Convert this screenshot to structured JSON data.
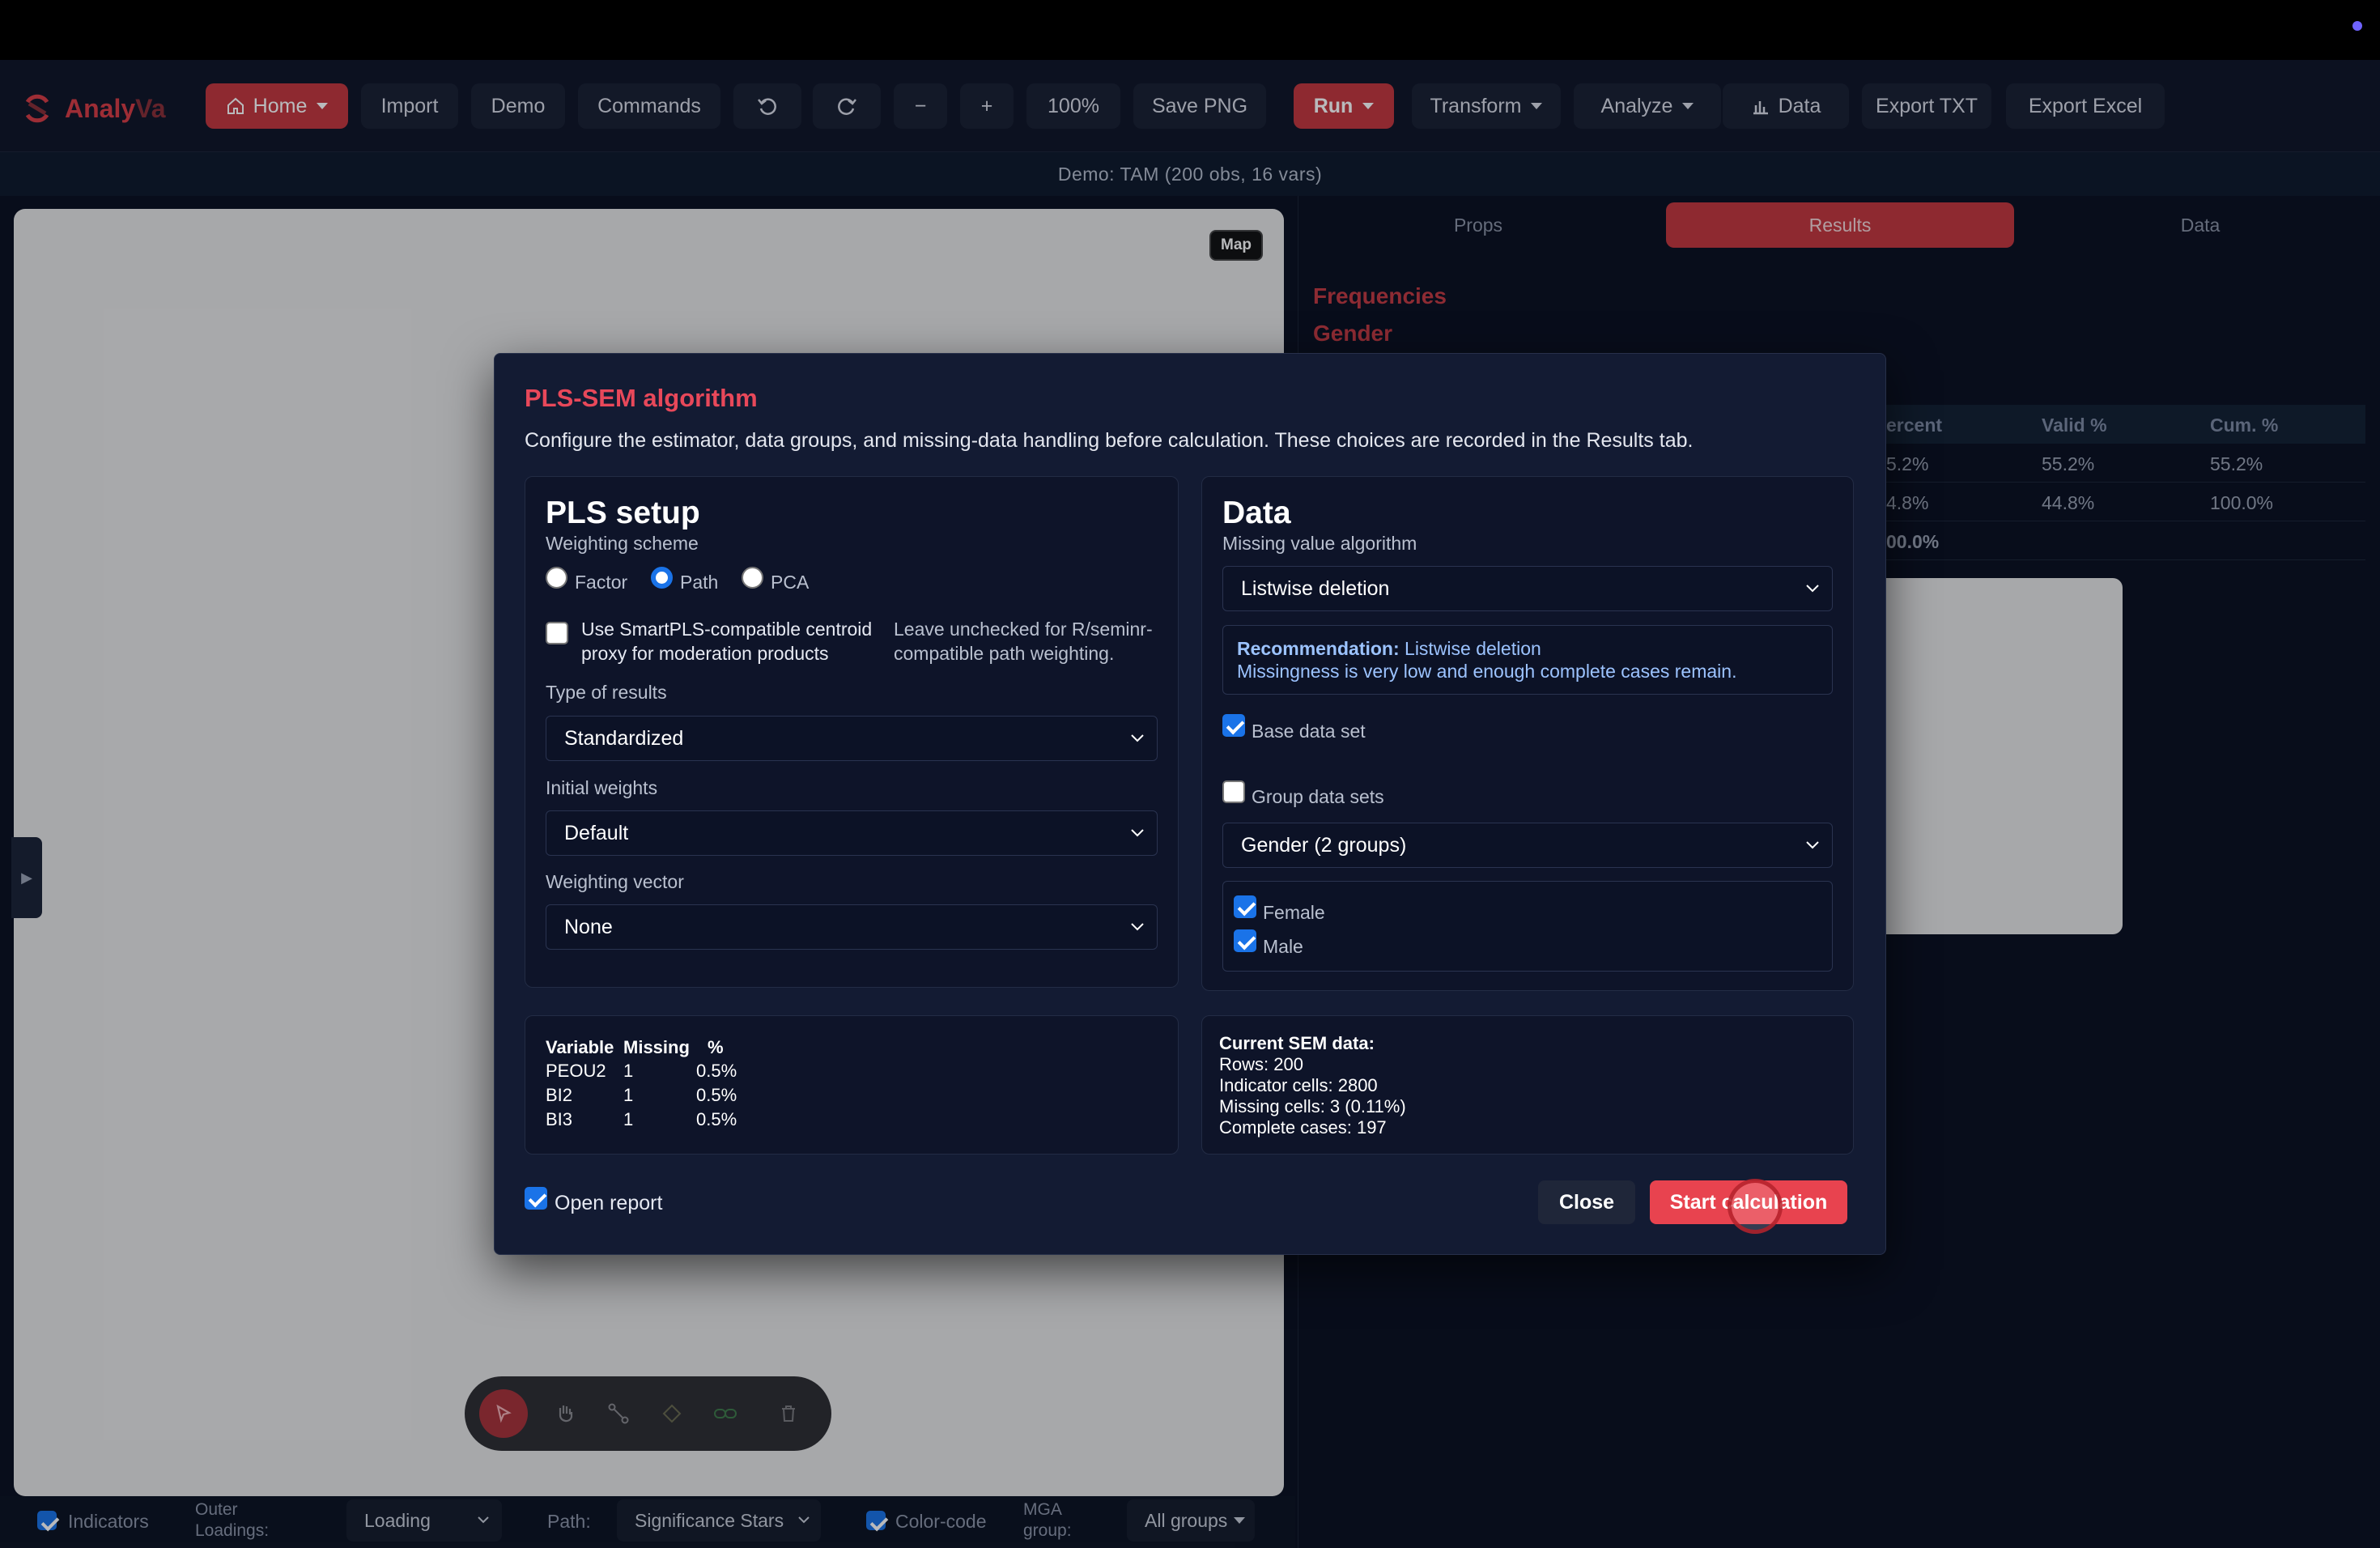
{
  "app": {
    "name_part1": "Analy",
    "name_part2": "Va"
  },
  "toolbar": {
    "home": "Home",
    "import": "Import",
    "demo": "Demo",
    "commands": "Commands",
    "minus": "−",
    "plus": "+",
    "zoom": "100%",
    "save_png": "Save PNG",
    "run": "Run",
    "transform": "Transform",
    "analyze": "Analyze",
    "data": "Data",
    "export_txt": "Export TXT",
    "export_excel": "Export Excel"
  },
  "demo_bar": "Demo: TAM (200 obs, 16 vars)",
  "canvas": {
    "map_label": "Map",
    "side_toggle": "▶"
  },
  "bottom_bar": {
    "indicators": "Indicators",
    "outer_loadings_1": "Outer",
    "outer_loadings_2": "Loadings:",
    "loading_value": "Loading",
    "path_label": "Path:",
    "path_value": "Significance Stars",
    "color_code": "Color-code",
    "mga_1": "MGA",
    "mga_2": "group:",
    "mga_value": "All groups"
  },
  "right_panel": {
    "tabs": [
      "Props",
      "Results",
      "Data"
    ],
    "active_tab": "Results",
    "section_title": "Frequencies",
    "variable": "Gender",
    "table": {
      "headers": [
        "ercent",
        "Valid %",
        "Cum. %"
      ],
      "rows": [
        [
          "5.2%",
          "55.2%",
          "55.2%"
        ],
        [
          "4.8%",
          "44.8%",
          "100.0%"
        ],
        [
          "00.0%",
          "",
          ""
        ]
      ]
    }
  },
  "modal": {
    "title": "PLS-SEM algorithm",
    "description": "Configure the estimator, data groups, and missing-data handling before calculation. These choices are recorded in the Results tab.",
    "pls_setup": {
      "heading": "PLS setup",
      "weighting_scheme_label": "Weighting scheme",
      "schemes": [
        "Factor",
        "Path",
        "PCA"
      ],
      "selected_scheme": "Path",
      "centroid_line1": "Use SmartPLS-compatible centroid",
      "centroid_line2": "proxy for moderation products",
      "centroid_hint1": "Leave unchecked for R/seminr-",
      "centroid_hint2": "compatible path weighting.",
      "type_of_results_label": "Type of results",
      "type_of_results": "Standardized",
      "initial_weights_label": "Initial weights",
      "initial_weights": "Default",
      "weighting_vector_label": "Weighting vector",
      "weighting_vector": "None"
    },
    "data": {
      "heading": "Data",
      "missing_label": "Missing value algorithm",
      "missing_value": "Listwise deletion",
      "recommendation_label": "Recommendation:",
      "recommendation_value": "Listwise deletion",
      "recommendation_note": "Missingness is very low and enough complete cases remain.",
      "base_data_set": "Base data set",
      "group_data_sets": "Group data sets",
      "group_select": "Gender (2 groups)",
      "groups": [
        "Female",
        "Male"
      ]
    },
    "missing_table": {
      "headers": [
        "Variable",
        "Missing",
        "%"
      ],
      "rows": [
        [
          "PEOU2",
          "1",
          "0.5%"
        ],
        [
          "BI2",
          "1",
          "0.5%"
        ],
        [
          "BI3",
          "1",
          "0.5%"
        ]
      ]
    },
    "current_sem": {
      "title": "Current SEM data:",
      "rows": "Rows: 200",
      "indicator_cells": "Indicator cells: 2800",
      "missing_cells": "Missing cells: 3 (0.11%)",
      "complete_cases": "Complete cases: 197"
    },
    "open_report": "Open report",
    "close_button": "Close",
    "start_button": "Start calculation"
  }
}
